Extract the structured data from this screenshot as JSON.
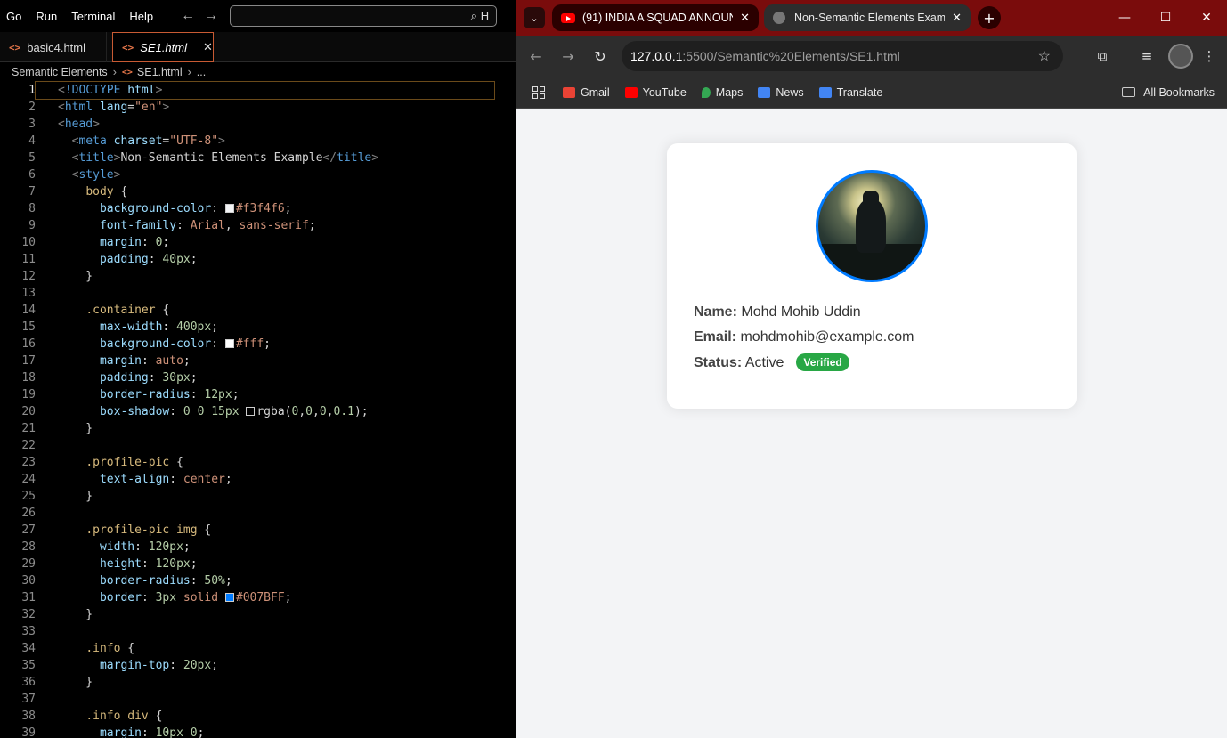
{
  "editor": {
    "menu": [
      "Go",
      "Run",
      "Terminal",
      "Help"
    ],
    "search_text": "H",
    "tabs": [
      {
        "label": "basic4.html",
        "active": false
      },
      {
        "label": "SE1.html",
        "active": true
      }
    ],
    "breadcrumb": [
      "Semantic Elements",
      "SE1.html",
      "..."
    ],
    "current_line": 1,
    "swatch_colors": {
      "bg": "#f3f4f6",
      "white": "#fff",
      "shadow": "rgba(0,0,0,0.1)",
      "blue": "#007BFF"
    }
  },
  "browser": {
    "tabs": [
      {
        "title": "(91) INDIA A SQUAD ANNOUNC",
        "icon": "youtube-icon",
        "active": false
      },
      {
        "title": "Non-Semantic Elements Examp",
        "icon": "globe-icon",
        "active": true
      }
    ],
    "url_host": "127.0.0.1",
    "url_path": ":5500/Semantic%20Elements/SE1.html",
    "bookmarks": [
      {
        "label": "Gmail",
        "color": "#ea4335"
      },
      {
        "label": "YouTube",
        "color": "#ff0000"
      },
      {
        "label": "Maps",
        "color": "#34a853"
      },
      {
        "label": "News",
        "color": "#4285f4"
      },
      {
        "label": "Translate",
        "color": "#4285f4"
      }
    ],
    "all_bookmarks": "All Bookmarks"
  },
  "page": {
    "name_label": "Name:",
    "name_value": "Mohd Mohib Uddin",
    "email_label": "Email:",
    "email_value": "mohdmohib@example.com",
    "status_label": "Status:",
    "status_value": "Active",
    "badge": "Verified",
    "accent": "#007BFF",
    "badge_color": "#28a745"
  }
}
